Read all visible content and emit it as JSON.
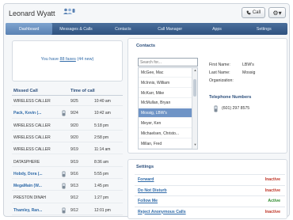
{
  "header": {
    "username": "Leonard Wyatt",
    "call_button_label": "Call",
    "gear_label": "▾"
  },
  "nav": {
    "tabs": [
      {
        "label": "Dashboard",
        "active": true
      },
      {
        "label": "Messages & Calls",
        "active": false
      },
      {
        "label": "Contacts",
        "active": false
      },
      {
        "label": "Call Manager",
        "active": false
      },
      {
        "label": "Apps",
        "active": false
      },
      {
        "label": "Settings",
        "active": false
      }
    ]
  },
  "messages": {
    "prefix": "You have ",
    "link": "88 faxes",
    "suffix": " (44 new)"
  },
  "missed_calls": {
    "col_caller": "Missed Call",
    "col_time": "Time of call",
    "rows": [
      {
        "name": "WIRELESS CALLER",
        "date": "9/25",
        "time": "10:40 am",
        "link": false,
        "phone": false
      },
      {
        "name": "Pack, Kevin (...",
        "date": "9/24",
        "time": "10:42 am",
        "link": true,
        "phone": true
      },
      {
        "name": "WIRELESS CALLER",
        "date": "9/20",
        "time": "5:18 pm",
        "link": false,
        "phone": false
      },
      {
        "name": "WIRELESS CALLER",
        "date": "9/20",
        "time": "2:58 pm",
        "link": false,
        "phone": false
      },
      {
        "name": "WIRELESS CALLER",
        "date": "9/19",
        "time": "11:14 am",
        "link": false,
        "phone": false
      },
      {
        "name": "DATASPHERE",
        "date": "9/19",
        "time": "8:36 am",
        "link": false,
        "phone": false
      },
      {
        "name": "Hobdy, Dora (...",
        "date": "9/16",
        "time": "5:55 pm",
        "link": true,
        "phone": true
      },
      {
        "name": "MegaMain (W...",
        "date": "9/13",
        "time": "1:45 pm",
        "link": true,
        "phone": true
      },
      {
        "name": "PRESTON DINAH",
        "date": "9/12",
        "time": "1:27 pm",
        "link": false,
        "phone": false
      },
      {
        "name": "Thamley, Ran...",
        "date": "9/12",
        "time": "12:01 pm",
        "link": true,
        "phone": true
      }
    ]
  },
  "contacts": {
    "title": "Contacts",
    "search_placeholder": "Search for...",
    "list": [
      {
        "name": "McGee, Mac",
        "selected": false
      },
      {
        "name": "McInnis, William",
        "selected": false
      },
      {
        "name": "McKarr, Mike",
        "selected": false
      },
      {
        "name": "McMullan, Bryan",
        "selected": false
      },
      {
        "name": "Mossig, LBW's",
        "selected": true
      },
      {
        "name": "Meyer, Ken",
        "selected": false
      },
      {
        "name": "Michaelsen, Christo...",
        "selected": false
      },
      {
        "name": "Millan, Fred",
        "selected": false
      }
    ],
    "detail": {
      "first_name_label": "First Name:",
      "first_name": "LBW's",
      "last_name_label": "Last Name:",
      "last_name": "Mossig",
      "org_label": "Organization:",
      "org": "",
      "telephone_title": "Telephone Numbers",
      "telephone": "(601) 297 8575"
    }
  },
  "settings": {
    "title": "Settings",
    "rows": [
      {
        "name": "Forward",
        "status": "Inactive"
      },
      {
        "name": "Do Not Disturb",
        "status": "Inactive"
      },
      {
        "name": "Follow Me",
        "status": "Active"
      },
      {
        "name": "Reject Anonymous Calls",
        "status": "Inactive"
      }
    ]
  },
  "colors": {
    "nav_bg": "#2f527f",
    "accent": "#2c4f7c",
    "link": "#2f6aa8",
    "active": "#2e8b2e",
    "inactive": "#c0392b",
    "selected_bg": "#6f94c6"
  },
  "icons": [
    "users-icon",
    "phone-icon",
    "gear-icon",
    "chevron-down-icon",
    "scroll-up-icon",
    "scroll-down-icon"
  ]
}
